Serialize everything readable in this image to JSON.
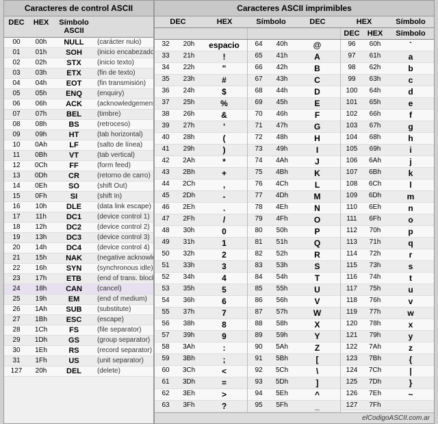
{
  "leftPanel": {
    "title": "Caracteres de control ASCII",
    "cols": [
      "DEC",
      "HEX",
      "Símbolo ASCII",
      ""
    ],
    "rows": [
      [
        "00",
        "00h",
        "NULL",
        "(carácter nulo)"
      ],
      [
        "01",
        "01h",
        "SOH",
        "(inicio encabezado)"
      ],
      [
        "02",
        "02h",
        "STX",
        "(inicio texto)"
      ],
      [
        "03",
        "03h",
        "ETX",
        "(fin de texto)"
      ],
      [
        "04",
        "04h",
        "EOT",
        "(fin transmisión)"
      ],
      [
        "05",
        "05h",
        "ENQ",
        "(enquiry)"
      ],
      [
        "06",
        "06h",
        "ACK",
        "(acknowledgement)"
      ],
      [
        "07",
        "07h",
        "BEL",
        "(timbre)"
      ],
      [
        "08",
        "08h",
        "BS",
        "(retroceso)"
      ],
      [
        "09",
        "09h",
        "HT",
        "(tab horizontal)"
      ],
      [
        "10",
        "0Ah",
        "LF",
        "(salto de línea)"
      ],
      [
        "11",
        "0Bh",
        "VT",
        "(tab vertical)"
      ],
      [
        "12",
        "0Ch",
        "FF",
        "(form feed)"
      ],
      [
        "13",
        "0Dh",
        "CR",
        "(retorno de carro)"
      ],
      [
        "14",
        "0Eh",
        "SO",
        "(shift Out)"
      ],
      [
        "15",
        "0Fh",
        "SI",
        "(shift In)"
      ],
      [
        "16",
        "10h",
        "DLE",
        "(data link escape)"
      ],
      [
        "17",
        "11h",
        "DC1",
        "(device control 1)"
      ],
      [
        "18",
        "12h",
        "DC2",
        "(device control 2)"
      ],
      [
        "19",
        "13h",
        "DC3",
        "(device control 3)"
      ],
      [
        "20",
        "14h",
        "DC4",
        "(device control 4)"
      ],
      [
        "21",
        "15h",
        "NAK",
        "(negative acknowle.)"
      ],
      [
        "22",
        "16h",
        "SYN",
        "(synchronous idle)"
      ],
      [
        "23",
        "17h",
        "ETB",
        "(end of trans. block)"
      ],
      [
        "24",
        "18h",
        "CAN",
        "(cancel)"
      ],
      [
        "25",
        "19h",
        "EM",
        "(end of medium)"
      ],
      [
        "26",
        "1Ah",
        "SUB",
        "(substitute)"
      ],
      [
        "27",
        "1Bh",
        "ESC",
        "(escape)"
      ],
      [
        "28",
        "1Ch",
        "FS",
        "(file separator)"
      ],
      [
        "29",
        "1Dh",
        "GS",
        "(group separator)"
      ],
      [
        "30",
        "1Eh",
        "RS",
        "(record separator)"
      ],
      [
        "31",
        "1Fh",
        "US",
        "(unit separator)"
      ],
      [
        "127",
        "20h",
        "DEL",
        "(delete)"
      ]
    ]
  },
  "rightPanel": {
    "title": "Caracteres ASCII imprimibles",
    "colHeaders": [
      "DEC",
      "HEX",
      "Símbolo",
      "DEC",
      "HEX",
      "Símbolo",
      "DEC",
      "HEX",
      "Símbolo"
    ],
    "col1": [
      [
        "32",
        "20h",
        "espacio"
      ],
      [
        "33",
        "21h",
        "!"
      ],
      [
        "34",
        "22h",
        "\""
      ],
      [
        "35",
        "23h",
        "#"
      ],
      [
        "36",
        "24h",
        "$"
      ],
      [
        "37",
        "25h",
        "%"
      ],
      [
        "38",
        "26h",
        "&"
      ],
      [
        "39",
        "27h",
        "'"
      ],
      [
        "40",
        "28h",
        "("
      ],
      [
        "41",
        "29h",
        ")"
      ],
      [
        "42",
        "2Ah",
        "*"
      ],
      [
        "43",
        "2Bh",
        "+"
      ],
      [
        "44",
        "2Ch",
        ","
      ],
      [
        "45",
        "2Dh",
        "-"
      ],
      [
        "46",
        "2Eh",
        "."
      ],
      [
        "47",
        "2Fh",
        "/"
      ],
      [
        "48",
        "30h",
        "0"
      ],
      [
        "49",
        "31h",
        "1"
      ],
      [
        "50",
        "32h",
        "2"
      ],
      [
        "51",
        "33h",
        "3"
      ],
      [
        "52",
        "34h",
        "4"
      ],
      [
        "53",
        "35h",
        "5"
      ],
      [
        "54",
        "36h",
        "6"
      ],
      [
        "55",
        "37h",
        "7"
      ],
      [
        "56",
        "38h",
        "8"
      ],
      [
        "57",
        "39h",
        "9"
      ],
      [
        "58",
        "3Ah",
        ":"
      ],
      [
        "59",
        "3Bh",
        ";"
      ],
      [
        "60",
        "3Ch",
        "<"
      ],
      [
        "61",
        "3Dh",
        "="
      ],
      [
        "62",
        "3Eh",
        ">"
      ],
      [
        "63",
        "3Fh",
        "?"
      ]
    ],
    "col2": [
      [
        "64",
        "40h",
        "@"
      ],
      [
        "65",
        "41h",
        "A"
      ],
      [
        "66",
        "42h",
        "B"
      ],
      [
        "67",
        "43h",
        "C"
      ],
      [
        "68",
        "44h",
        "D"
      ],
      [
        "69",
        "45h",
        "E"
      ],
      [
        "70",
        "46h",
        "F"
      ],
      [
        "71",
        "47h",
        "G"
      ],
      [
        "72",
        "48h",
        "H"
      ],
      [
        "73",
        "49h",
        "I"
      ],
      [
        "74",
        "4Ah",
        "J"
      ],
      [
        "75",
        "4Bh",
        "K"
      ],
      [
        "76",
        "4Ch",
        "L"
      ],
      [
        "77",
        "4Dh",
        "M"
      ],
      [
        "78",
        "4Eh",
        "N"
      ],
      [
        "79",
        "4Fh",
        "O"
      ],
      [
        "80",
        "50h",
        "P"
      ],
      [
        "81",
        "51h",
        "Q"
      ],
      [
        "82",
        "52h",
        "R"
      ],
      [
        "83",
        "53h",
        "S"
      ],
      [
        "84",
        "54h",
        "T"
      ],
      [
        "85",
        "55h",
        "U"
      ],
      [
        "86",
        "56h",
        "V"
      ],
      [
        "87",
        "57h",
        "W"
      ],
      [
        "88",
        "58h",
        "X"
      ],
      [
        "89",
        "59h",
        "Y"
      ],
      [
        "90",
        "5Ah",
        "Z"
      ],
      [
        "91",
        "5Bh",
        "["
      ],
      [
        "92",
        "5Ch",
        "\\"
      ],
      [
        "93",
        "5Dh",
        "]"
      ],
      [
        "94",
        "5Eh",
        "^"
      ],
      [
        "95",
        "5Fh",
        "_"
      ]
    ],
    "col3": [
      [
        "96",
        "60h",
        "`"
      ],
      [
        "97",
        "61h",
        "a"
      ],
      [
        "98",
        "62h",
        "b"
      ],
      [
        "99",
        "63h",
        "c"
      ],
      [
        "100",
        "64h",
        "d"
      ],
      [
        "101",
        "65h",
        "e"
      ],
      [
        "102",
        "66h",
        "f"
      ],
      [
        "103",
        "67h",
        "g"
      ],
      [
        "104",
        "68h",
        "h"
      ],
      [
        "105",
        "69h",
        "i"
      ],
      [
        "106",
        "6Ah",
        "j"
      ],
      [
        "107",
        "6Bh",
        "k"
      ],
      [
        "108",
        "6Ch",
        "l"
      ],
      [
        "109",
        "6Dh",
        "m"
      ],
      [
        "110",
        "6Eh",
        "n"
      ],
      [
        "111",
        "6Fh",
        "o"
      ],
      [
        "112",
        "70h",
        "p"
      ],
      [
        "113",
        "71h",
        "q"
      ],
      [
        "114",
        "72h",
        "r"
      ],
      [
        "115",
        "73h",
        "s"
      ],
      [
        "116",
        "74h",
        "t"
      ],
      [
        "117",
        "75h",
        "u"
      ],
      [
        "118",
        "76h",
        "v"
      ],
      [
        "119",
        "77h",
        "w"
      ],
      [
        "120",
        "78h",
        "x"
      ],
      [
        "121",
        "79h",
        "y"
      ],
      [
        "122",
        "7Ah",
        "z"
      ],
      [
        "123",
        "7Bh",
        "{"
      ],
      [
        "124",
        "7Ch",
        "|"
      ],
      [
        "125",
        "7Dh",
        "}"
      ],
      [
        "126",
        "7Eh",
        "~"
      ],
      [
        "127",
        "7Fh",
        ""
      ]
    ],
    "footer": "elCodigoASCII.com.ar"
  }
}
